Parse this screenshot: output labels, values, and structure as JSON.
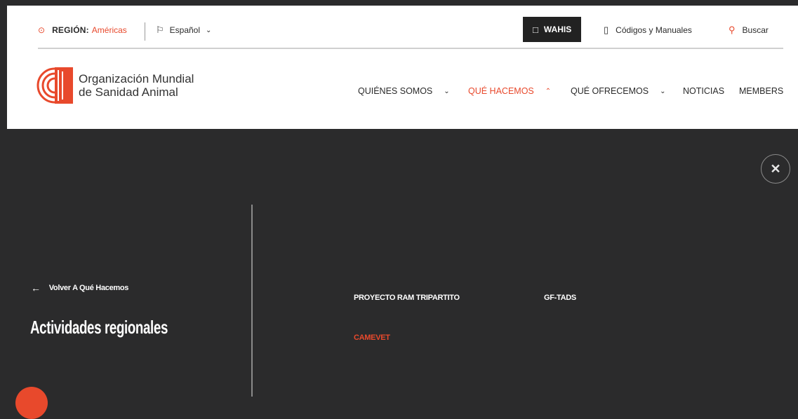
{
  "utility": {
    "region_label": "REGIÓN:",
    "region_value": "Américas",
    "language": "Español",
    "wahis": "WAHIS",
    "codes": "Códigos y Manuales",
    "search": "Buscar"
  },
  "logo": {
    "line1": "Organización Mundial",
    "line2": "de Sanidad Animal"
  },
  "nav": {
    "items": [
      {
        "label": "QUIÉNES SOMOS"
      },
      {
        "label": "QUÉ HACEMOS"
      },
      {
        "label": "QUÉ OFRECEMOS"
      },
      {
        "label": "NOTICIAS"
      },
      {
        "label": "MEMBERS"
      }
    ]
  },
  "menu": {
    "back": "Volver A Qué Hacemos",
    "title": "Actividades regionales",
    "links": [
      {
        "label": "PROYECTO RAM TRIPARTITO"
      },
      {
        "label": "GF-TADS"
      },
      {
        "label": "CAMEVET"
      }
    ]
  },
  "colors": {
    "accent": "#e8492c",
    "overlay": "#2b2b2c"
  }
}
